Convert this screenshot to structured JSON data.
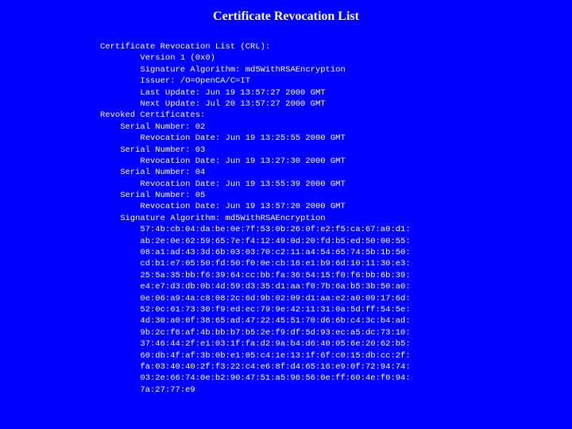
{
  "colors": {
    "background": "#0000ff",
    "text": "#ffffff"
  },
  "slide": {
    "title": "Certificate Revocation List",
    "lines": [
      "Certificate Revocation List (CRL):",
      "        Version 1 (0x0)",
      "        Signature Algorithm: md5WithRSAEncryption",
      "        Issuer: /O=OpenCA/C=IT",
      "        Last Update: Jun 19 13:57:27 2000 GMT",
      "        Next Update: Jul 20 13:57:27 2000 GMT",
      "Revoked Certificates:",
      "    Serial Number: 02",
      "        Revocation Date: Jun 19 13:25:55 2000 GMT",
      "    Serial Number: 03",
      "        Revocation Date: Jun 19 13:27:30 2000 GMT",
      "    Serial Number: 04",
      "        Revocation Date: Jun 19 13:55:39 2000 GMT",
      "    Serial Number: 05",
      "        Revocation Date: Jun 19 13:57:20 2000 GMT",
      "    Signature Algorithm: md5WithRSAEncryption",
      "        57:4b:cb:04:da:be:0e:7f:53:0b:26:0f:e2:f5:ca:67:a0:d1:",
      "        ab:2e:0e:62:59:65:7e:f4:12:49:0d:20:fd:b5:ed:50:00:55:",
      "        08:a1:ad:43:3d:6b:03:03:70:c2:11:a4:54:65:74:5b:1b:50:",
      "        cd:b1:e7:05:50:fd:50:f0:0e:cb:16:e1:b9:6d:10:11:30:e3:",
      "        25:5a:35:bb:f6:39:64:cc:bb:fa:36:54:15:f0:f6:bb:6b:39:",
      "        e4:e7:d3:db:0b:4d:59:d3:35:d1:aa:f0:7b:6a:b5:3b:50:a0:",
      "        0e:06:a9:4a:c8:08:2c:6d:9b:02:09:d1:aa:e2:a0:09:17:6d:",
      "        52:0c:61:73:30:f9:ed:ec:79:9e:42:11:31:0a:5d:ff:54:5e:",
      "        4d:30:a0:0f:38:65:ad:47:22:45:51:70:d6:6b:c4:3c:b4:ad:",
      "        9b:2c:f6:af:4b:bb:b7:b5:2e:f9:df:5d:93:ec:a5:dc:73:10:",
      "        37:46:44:2f:e1:03:1f:fa:d2:9a:b4:d6:40:05:6e:20:62:b5:",
      "        60:db:4f:af:3b:0b:e1:05:c4:1e:13:1f:6f:c0:15:db:cc:2f:",
      "        fa:03:40:40:2f:f3:22:c4:e6:8f:d4:65:16:e9:0f:72:94:74:",
      "        03:2e:66:74:0e:b2:90:47:51:a5:96:56:0e:ff:60:4e:f0:94:",
      "        7a:27:77:e9"
    ]
  }
}
